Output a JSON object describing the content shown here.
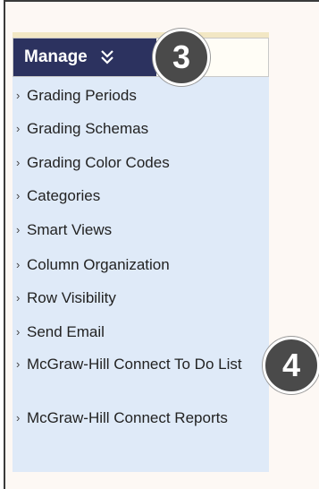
{
  "menu": {
    "title": "Manage",
    "items": [
      {
        "label": "Grading Periods"
      },
      {
        "label": "Grading Schemas"
      },
      {
        "label": "Grading Color Codes"
      },
      {
        "label": "Categories"
      },
      {
        "label": "Smart Views"
      },
      {
        "label": "Column Organization"
      },
      {
        "label": "Row Visibility"
      },
      {
        "label": "Send Email"
      },
      {
        "label": "McGraw-Hill Connect To Do List"
      },
      {
        "label": "McGraw-Hill Connect Reports"
      }
    ]
  },
  "callouts": [
    {
      "number": "3"
    },
    {
      "number": "4"
    }
  ],
  "colors": {
    "header_bg": "#2c325f",
    "menu_bg": "#dfeaf8",
    "badge_bg": "#4a4a4a",
    "page_bg": "#fdf8f4"
  },
  "icons": {
    "header_toggle": "double-chevron-down-icon",
    "item_marker": "chevron-right-icon"
  }
}
